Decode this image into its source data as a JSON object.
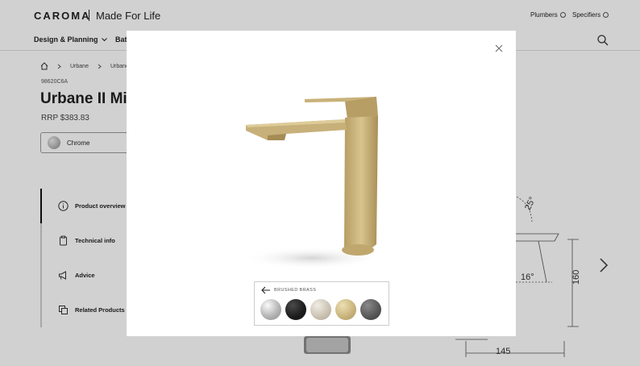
{
  "header": {
    "logo": "CAROMA",
    "tagline": "Made For Life",
    "links": [
      "Plumbers",
      "Specifiers"
    ],
    "nav": [
      "Design & Planning",
      "Bath"
    ]
  },
  "breadcrumb": [
    "Urbane",
    "Urbane"
  ],
  "product": {
    "sku": "98620C6A",
    "title": "Urbane II Mi",
    "price": "RRP $383.83",
    "selected_finish": "Chrome"
  },
  "side_menu": [
    "Product overview",
    "Technical info",
    "Advice",
    "Related Products"
  ],
  "drawing": {
    "angle_top": "25°",
    "angle_spout": "16°",
    "height": "160",
    "width": "145"
  },
  "modal": {
    "finish_label": "BRUSHED BRASS",
    "swatches": [
      "chrome",
      "matte-black",
      "brushed-nickel",
      "brushed-brass",
      "gunmetal"
    ]
  },
  "colors": {
    "brass": "#c7b07a",
    "overlay": "rgba(0,0,0,0.18)"
  }
}
